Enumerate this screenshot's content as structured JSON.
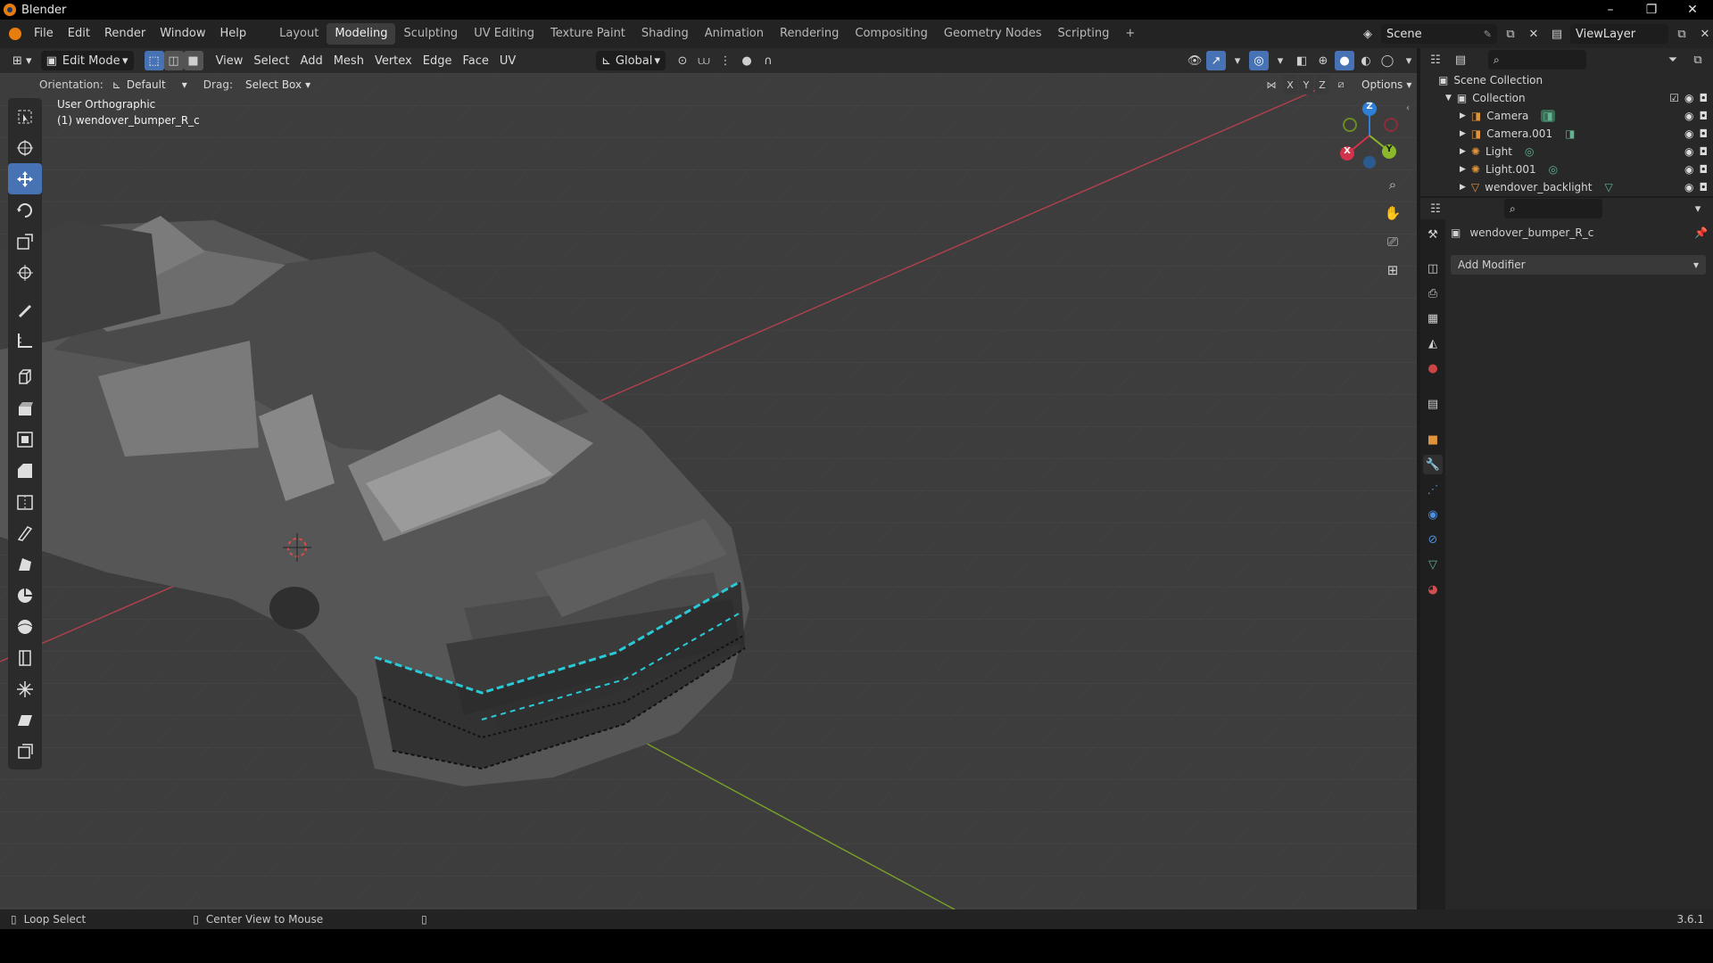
{
  "window": {
    "title": "Blender",
    "buttons": [
      "–",
      "❐",
      "✕"
    ]
  },
  "menu": [
    "File",
    "Edit",
    "Render",
    "Window",
    "Help"
  ],
  "workspaces": [
    "Layout",
    "Modeling",
    "Sculpting",
    "UV Editing",
    "Texture Paint",
    "Shading",
    "Animation",
    "Rendering",
    "Compositing",
    "Geometry Nodes",
    "Scripting"
  ],
  "active_workspace": "Modeling",
  "add_workspace": "+",
  "scene": {
    "name": "Scene",
    "view_layer": "ViewLayer"
  },
  "viewport_header": {
    "mode": "Edit Mode",
    "menus": [
      "View",
      "Select",
      "Add",
      "Mesh",
      "Vertex",
      "Edge",
      "Face",
      "UV"
    ],
    "transform_orientation": "Global"
  },
  "tool_header": {
    "orientation_label": "Orientation:",
    "orientation_value": "Default",
    "drag_label": "Drag:",
    "drag_value": "Select Box",
    "axes": [
      "X",
      "Y",
      "Z"
    ],
    "options": "Options"
  },
  "viewport": {
    "view_name": "User Orthographic",
    "object_name": "(1) wendover_bumper_R_c",
    "gizmo": {
      "z": "Z",
      "x": "X",
      "y": "Y"
    }
  },
  "outliner": {
    "root": "Scene Collection",
    "collection": "Collection",
    "items": [
      {
        "name": "Camera"
      },
      {
        "name": "Camera.001"
      },
      {
        "name": "Light"
      },
      {
        "name": "Light.001"
      },
      {
        "name": "wendover_backlight"
      }
    ]
  },
  "properties": {
    "object_name": "wendover_bumper_R_c",
    "add_modifier": "Add Modifier"
  },
  "statusbar": {
    "left": "Loop Select",
    "middle": "Center View to Mouse",
    "version": "3.6.1"
  },
  "colors": {
    "accent": "#4772b3",
    "viewport_bg": "#3d3d3d",
    "selection": "#29c9d6",
    "x_axis": "#d1334a",
    "y_axis": "#8bb82a",
    "z_axis": "#2f7fd7"
  }
}
